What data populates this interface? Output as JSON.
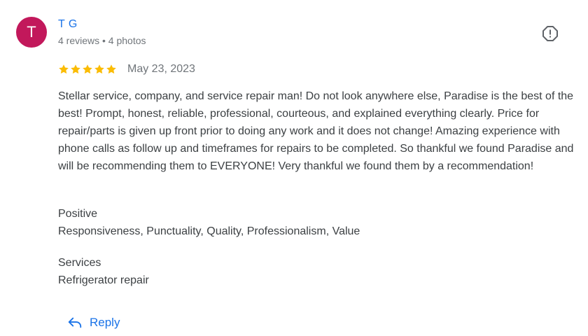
{
  "author": {
    "initial": "T",
    "name": "T G",
    "meta": "4 reviews • 4 photos"
  },
  "review": {
    "rating": 5,
    "date": "May 23, 2023",
    "text": "Stellar service, company, and service repair man! Do not look anywhere else, Paradise is the best of the best! Prompt, honest, reliable, professional, courteous, and explained everything clearly. Price for repair/parts is given up front prior to doing any work and it does not change! Amazing experience with phone calls as follow up and timeframes for repairs to be completed. So thankful we found Paradise and will be recommending them to EVERYONE! Very thankful we found them by a recommendation!"
  },
  "positive": {
    "heading": "Positive",
    "value": "Responsiveness, Punctuality, Quality, Professionalism, Value"
  },
  "services": {
    "heading": "Services",
    "value": "Refrigerator repair"
  },
  "actions": {
    "reply_label": "Reply"
  },
  "icons": {
    "report": "report-icon",
    "star": "star-icon",
    "reply": "reply-icon"
  },
  "colors": {
    "avatar_bg": "#c2185b",
    "link": "#1a73e8",
    "star": "#fbbc04",
    "text": "#3c4043",
    "muted": "#70757a"
  }
}
